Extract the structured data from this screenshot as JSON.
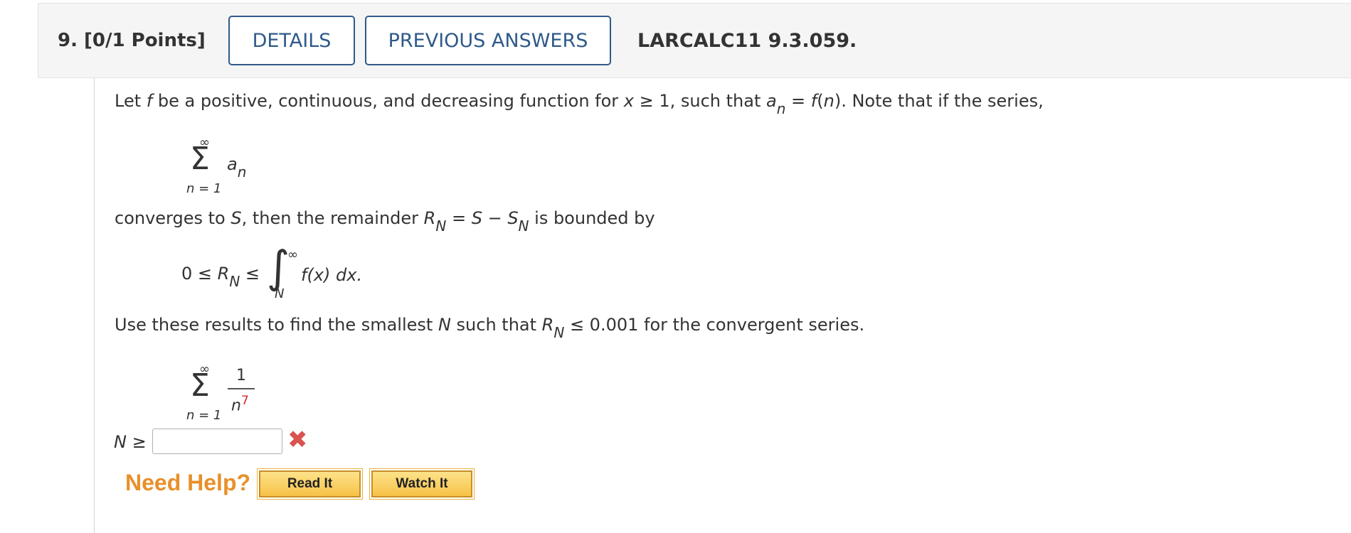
{
  "header": {
    "question_number": "9.",
    "points": "[0/1 Points]",
    "details_label": "DETAILS",
    "previous_answers_label": "PREVIOUS ANSWERS",
    "problem_code": "LARCALC11 9.3.059."
  },
  "problem": {
    "line1": {
      "t1": "Let ",
      "f": "f",
      "t2": " be a positive, continuous, and decreasing function for ",
      "x": "x",
      "t3": " ≥ 1, such that ",
      "a": "a",
      "a_sub": "n",
      "t4": " = ",
      "fn1": "f",
      "t5": "(",
      "n": "n",
      "t6": "). Note that if the series,"
    },
    "series1": {
      "upper": "∞",
      "sigma": "Σ",
      "term": "a",
      "term_sub": "n",
      "lower": "n = 1"
    },
    "line2": {
      "t1": "converges to ",
      "S": "S",
      "t2": ", then the remainder ",
      "R": "R",
      "R_sub": "N",
      "t3": " = ",
      "S2": "S",
      "t4": " − ",
      "S3": "S",
      "S3_sub": "N",
      "t5": " is bounded by"
    },
    "inequality": {
      "lhs": "0 ≤ ",
      "R": "R",
      "R_sub": "N",
      "le": " ≤",
      "integral": "∫",
      "upper": "∞",
      "lower": "N",
      "integrand": "f(x) dx."
    },
    "line3": {
      "t1": "Use these results to find the smallest ",
      "N": "N",
      "t2": " such that ",
      "R": "R",
      "R_sub": "N",
      "t3": " ≤ 0.001 for the convergent series."
    },
    "series2": {
      "upper": "∞",
      "sigma": "Σ",
      "numerator": "1",
      "denominator_base": "n",
      "denominator_exp": "7",
      "lower": "n = 1"
    },
    "answer": {
      "label_var": "N",
      "label_op": " ≥",
      "value": "",
      "status_icon": "x-mark-icon",
      "status_color": "#d9534f"
    }
  },
  "help": {
    "title": "Need Help?",
    "read_it": "Read It",
    "watch_it": "Watch It"
  },
  "colors": {
    "link_blue": "#2f5a8a",
    "help_orange": "#e8902a",
    "exponent_red": "#d42a2a"
  }
}
